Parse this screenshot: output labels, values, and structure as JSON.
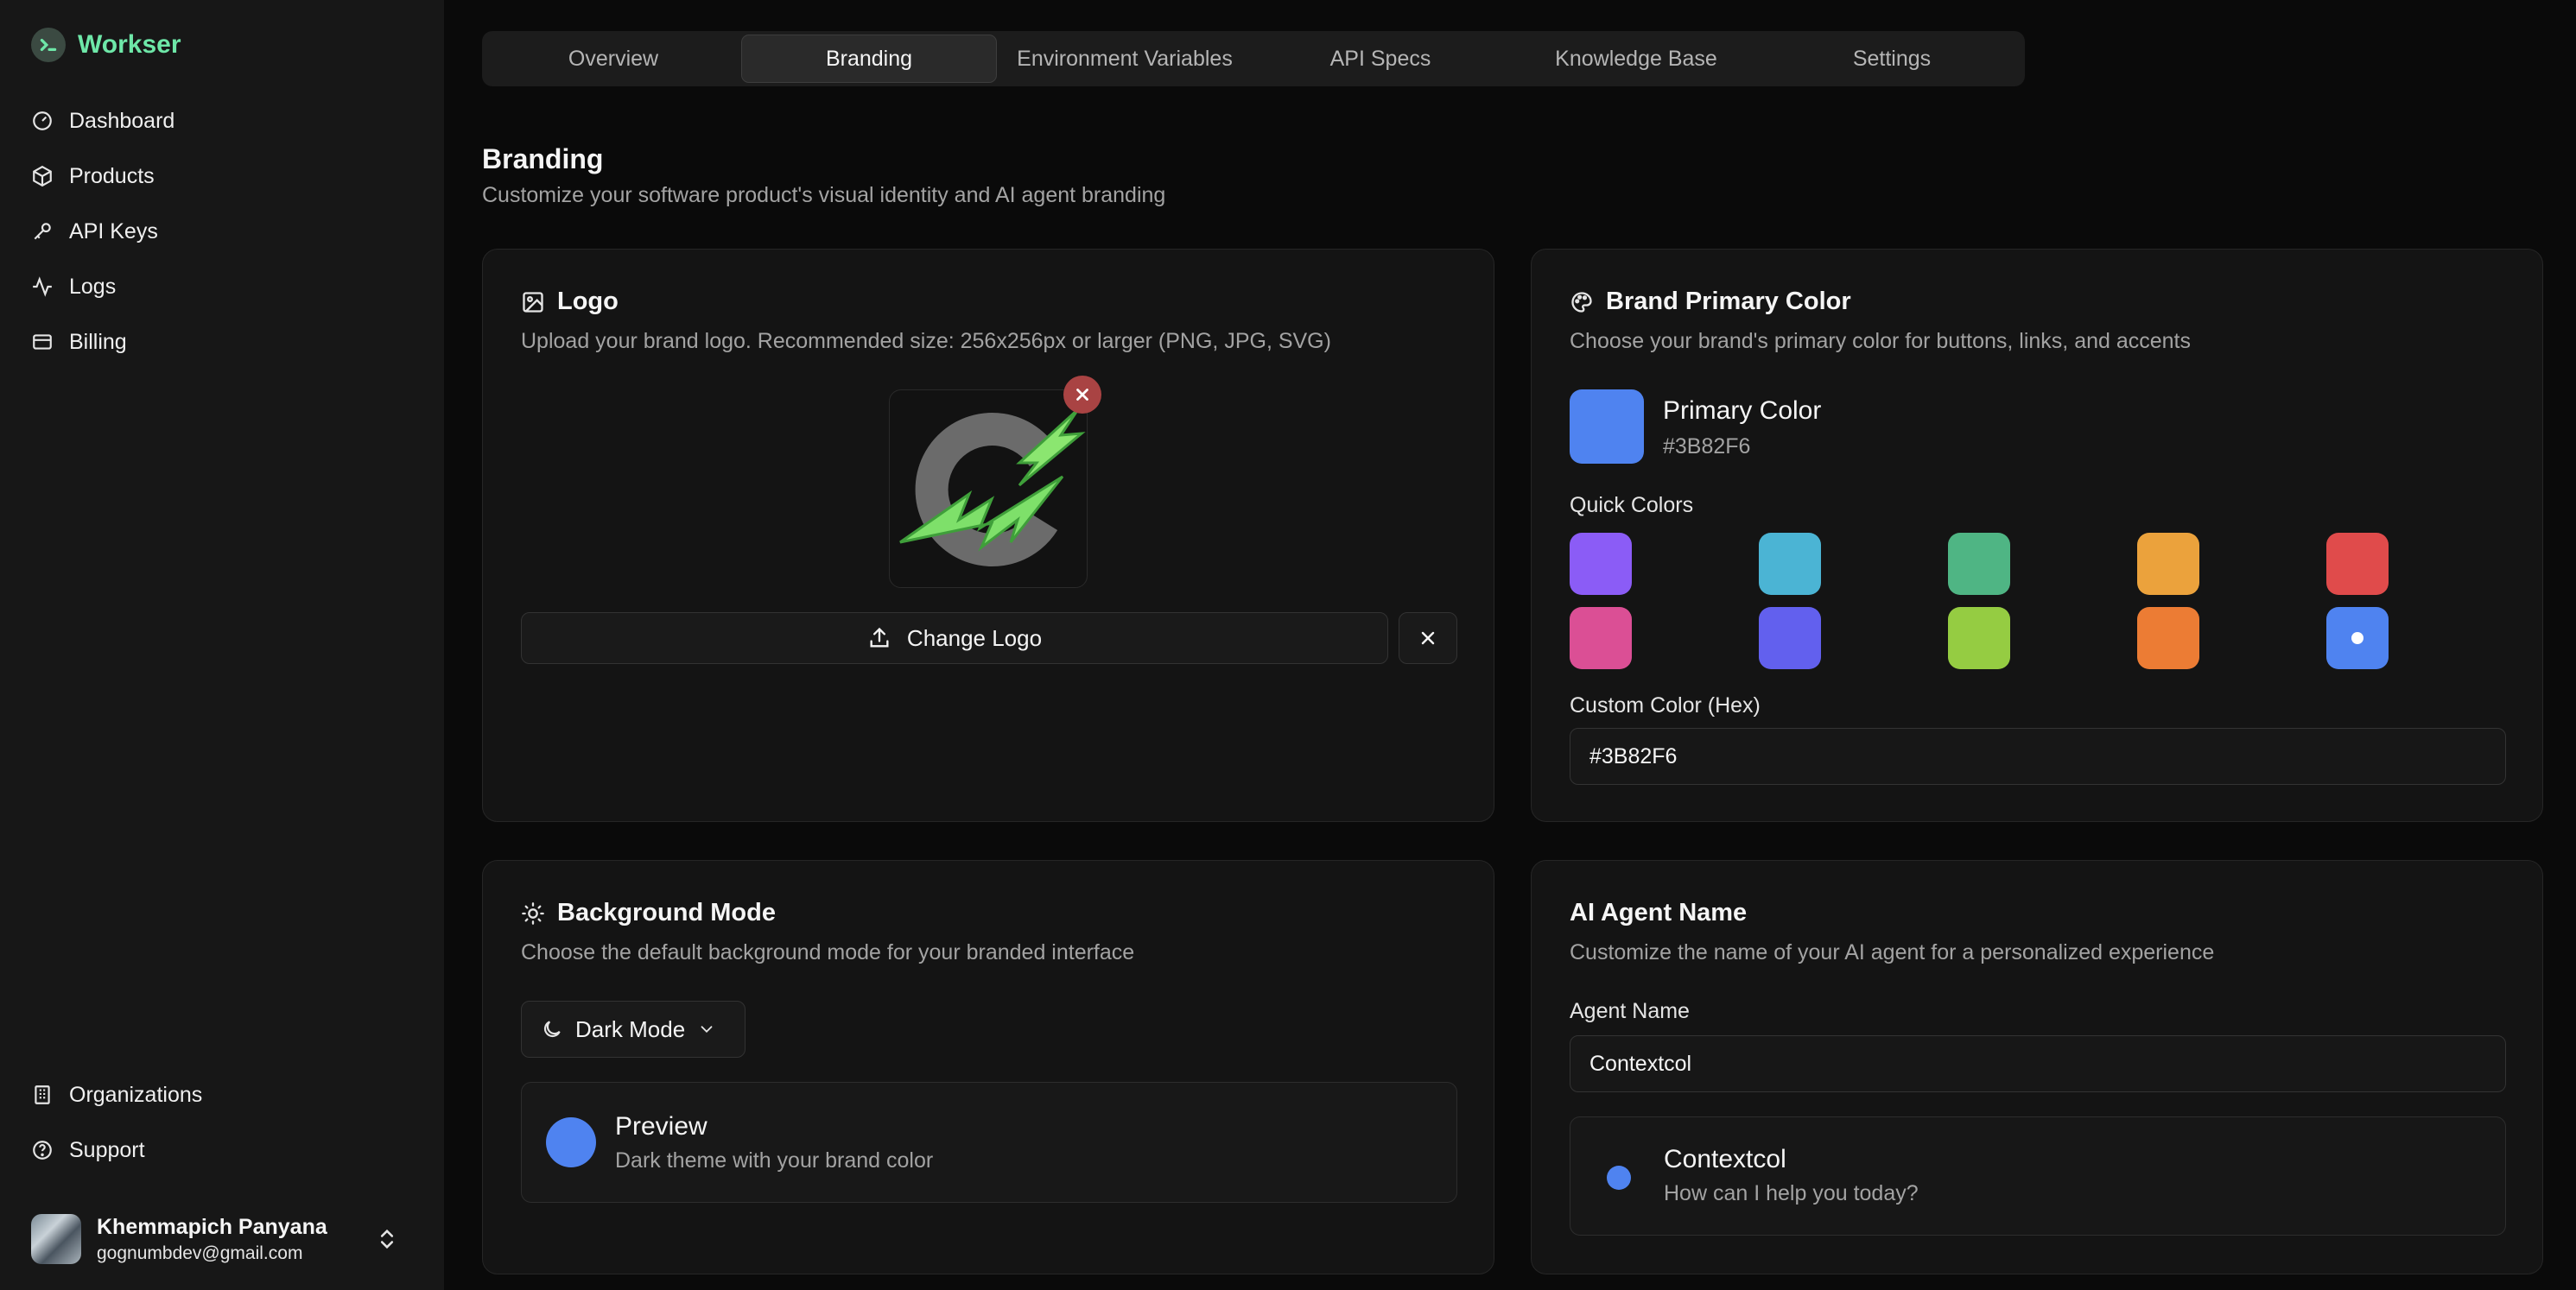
{
  "app": {
    "name": "Workser"
  },
  "sidebar": {
    "items": [
      {
        "label": "Dashboard",
        "icon": "dashboard-icon"
      },
      {
        "label": "Products",
        "icon": "box-icon"
      },
      {
        "label": "API Keys",
        "icon": "key-icon"
      },
      {
        "label": "Logs",
        "icon": "activity-icon"
      },
      {
        "label": "Billing",
        "icon": "credit-card-icon"
      }
    ],
    "bottom_items": [
      {
        "label": "Organizations",
        "icon": "building-icon"
      },
      {
        "label": "Support",
        "icon": "help-circle-icon"
      }
    ],
    "user": {
      "name": "Khemmapich Panyana",
      "email": "gognumbdev@gmail.com"
    }
  },
  "tabs": [
    {
      "label": "Overview",
      "active": false
    },
    {
      "label": "Branding",
      "active": true
    },
    {
      "label": "Environment Variables",
      "active": false
    },
    {
      "label": "API Specs",
      "active": false
    },
    {
      "label": "Knowledge Base",
      "active": false
    },
    {
      "label": "Settings",
      "active": false
    }
  ],
  "page": {
    "title": "Branding",
    "subtitle": "Customize your software product's visual identity and AI agent branding"
  },
  "logo_card": {
    "title": "Logo",
    "description": "Upload your brand logo. Recommended size: 256x256px or larger (PNG, JPG, SVG)",
    "change_label": "Change Logo"
  },
  "color_card": {
    "title": "Brand Primary Color",
    "description": "Choose your brand's primary color for buttons, links, and accents",
    "primary_label": "Primary Color",
    "primary_hex": "#3B82F6",
    "quick_label": "Quick Colors",
    "quick_colors": [
      "#8B5CF6",
      "#4BB4D4",
      "#4FB584",
      "#EBA23C",
      "#E04B4B",
      "#DB4F95",
      "#6260EE",
      "#95CC42",
      "#EC7C34",
      "#4F83F0"
    ],
    "selected_index": 9,
    "custom_label": "Custom Color (Hex)",
    "custom_value": "#3B82F6"
  },
  "background_card": {
    "title": "Background Mode",
    "description": "Choose the default background mode for your branded interface",
    "mode_value": "Dark Mode",
    "preview_title": "Preview",
    "preview_sub": "Dark theme with your brand color"
  },
  "agent_card": {
    "title": "AI Agent Name",
    "description": "Customize the name of your AI agent for a personalized experience",
    "field_label": "Agent Name",
    "value": "Contextcol",
    "preview_name": "Contextcol",
    "preview_sub": "How can I help you today?"
  },
  "colors": {
    "brand_green": "#6EE7A8",
    "primary": "#4F83F0",
    "remove_red": "#A94343"
  }
}
